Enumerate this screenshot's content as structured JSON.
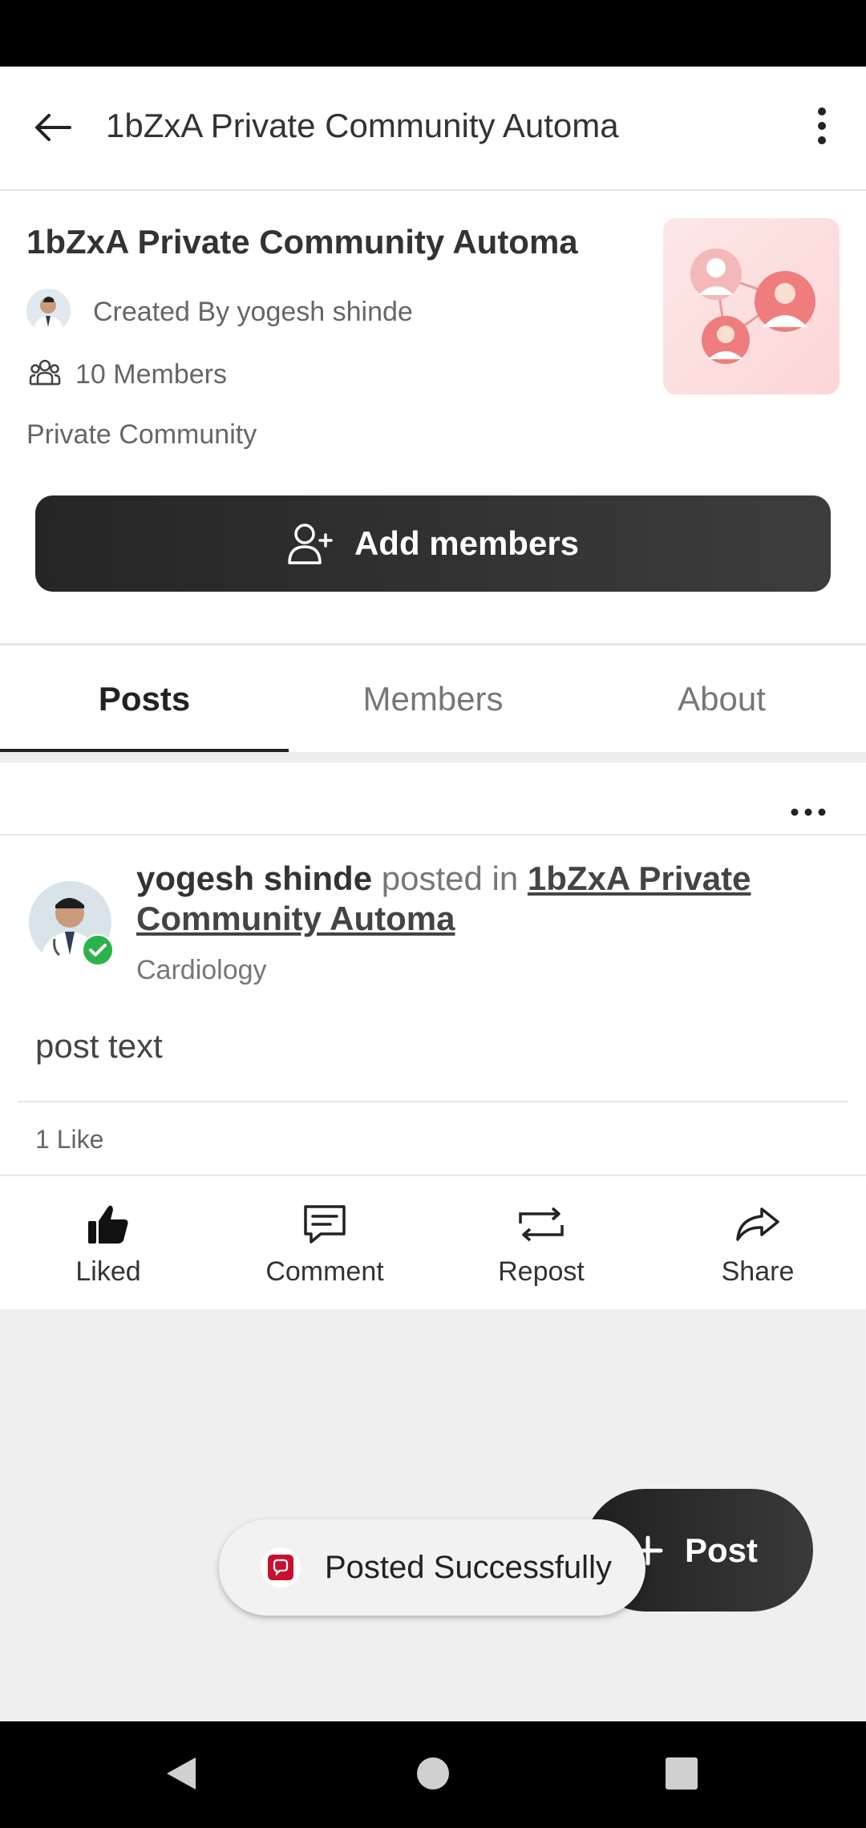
{
  "app_bar": {
    "title": "1bZxA Private Community Automa"
  },
  "community": {
    "name": "1bZxA Private Community Automa",
    "created_by": "Created By yogesh shinde",
    "members": "10 Members",
    "privacy": "Private Community",
    "add_members_label": "Add members"
  },
  "tabs": [
    {
      "label": "Posts",
      "active": true
    },
    {
      "label": "Members",
      "active": false
    },
    {
      "label": "About",
      "active": false
    }
  ],
  "post": {
    "author": "yogesh shinde",
    "posted_in": "posted in",
    "community": "1bZxA Private Community Automa",
    "specialty": "Cardiology",
    "text": "post text",
    "likes": "1 Like",
    "actions": [
      {
        "label": "Liked",
        "icon": "thumbs-up-icon"
      },
      {
        "label": "Comment",
        "icon": "comment-icon"
      },
      {
        "label": "Repost",
        "icon": "repost-icon"
      },
      {
        "label": "Share",
        "icon": "share-icon"
      }
    ]
  },
  "fab": {
    "label": "Post"
  },
  "toast": {
    "label": "Posted Successfully"
  },
  "colors": {
    "primary_dark": "#252525",
    "verified_green": "#2bb24c",
    "toast_icon_red": "#c8102e"
  }
}
